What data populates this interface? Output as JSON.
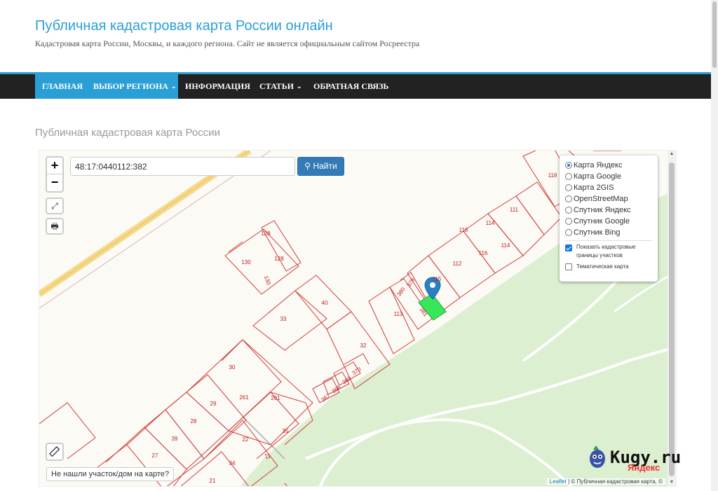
{
  "site": {
    "title": "Публичная кадастровая карта России онлайн",
    "tagline": "Кадастровая карта России, Москвы, и каждого региона. Сайт не является официальным сайтом Росреестра"
  },
  "nav": {
    "items": [
      {
        "label": "ГЛАВНАЯ",
        "active": true
      },
      {
        "label": "ВЫБОР РЕГИОНА",
        "has_dropdown": true
      },
      {
        "label": "ИНФОРМАЦИЯ"
      },
      {
        "label": "СТАТЬИ",
        "has_dropdown": true
      },
      {
        "label": "ОБРАТНАЯ СВЯЗЬ"
      }
    ]
  },
  "page": {
    "title": "Публичная кадастровая карта России"
  },
  "map": {
    "search_value": "48:17:0440112:382",
    "search_button": "Найти",
    "zoom_in": "+",
    "zoom_out": "−",
    "layers": {
      "options": [
        "Карта Яндекс",
        "Карта Google",
        "Карта 2GIS",
        "OpenStreetMap",
        "Спутник Яндекс",
        "Спутник Google",
        "Спутник Bing"
      ],
      "selected": "Карта Яндекс",
      "show_borders_label": "Показать кадастровые границы участков",
      "show_borders_checked": true,
      "thematic_label": "Тематическая карта",
      "thematic_checked": false
    },
    "not_found_button": "Не нашли участок/дом на карте?",
    "attribution_leaflet": "Leaflet",
    "attribution_text": "| © Публичная кадастровая карта, ©",
    "parcel_labels": [
      "128",
      "130",
      "128",
      "130",
      "33",
      "40",
      "32",
      "370",
      "369",
      "368",
      "367",
      "30",
      "261",
      "261",
      "29",
      "28",
      "39",
      "22",
      "35",
      "27",
      "34",
      "22",
      "21",
      "113",
      "380",
      "379",
      "381",
      "115",
      "112",
      "116",
      "116",
      "114",
      "114",
      "111",
      "118"
    ],
    "highlighted_parcel": "381",
    "watermark": "Kugy.ru",
    "yandex_logo": "Яндекс"
  },
  "colors": {
    "accent": "#2a9fd6",
    "navbar": "#222222",
    "parcel_border": "#d23c3c",
    "park": "#dcefd0",
    "highlight": "#39e65a",
    "marker": "#2a7fc5",
    "button": "#337ab7"
  }
}
